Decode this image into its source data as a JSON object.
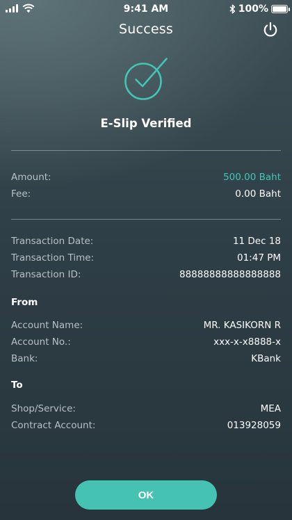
{
  "status_bar": {
    "time": "9:41 AM",
    "battery": "100%"
  },
  "header": {
    "title": "Success",
    "power_icon": "power-icon"
  },
  "verification": {
    "icon": "check-circle-icon",
    "title": "E-Slip Verified",
    "accent_color": "#41c6b5"
  },
  "amounts": [
    {
      "label": "Amount:",
      "value": "500.00 Baht"
    },
    {
      "label": "Fee:",
      "value": "0.00 Baht"
    }
  ],
  "transaction": [
    {
      "label": "Transaction Date:",
      "value": "11 Dec 18"
    },
    {
      "label": "Transaction Time:",
      "value": "01:47 PM"
    },
    {
      "label": "Transaction ID:",
      "value": "88888888888888888"
    }
  ],
  "from": {
    "heading": "From",
    "rows": [
      {
        "label": "Account Name:",
        "value": "MR. KASIKORN R"
      },
      {
        "label": "Account No.:",
        "value": "xxx-x-x8888-x"
      },
      {
        "label": "Bank:",
        "value": "KBank"
      }
    ]
  },
  "to": {
    "heading": "To",
    "rows": [
      {
        "label": "Shop/Service:",
        "value": "MEA"
      },
      {
        "label": "Contract Account:",
        "value": "013928059"
      }
    ]
  },
  "actions": {
    "ok_label": "OK",
    "button_color": "#45c2b2"
  }
}
